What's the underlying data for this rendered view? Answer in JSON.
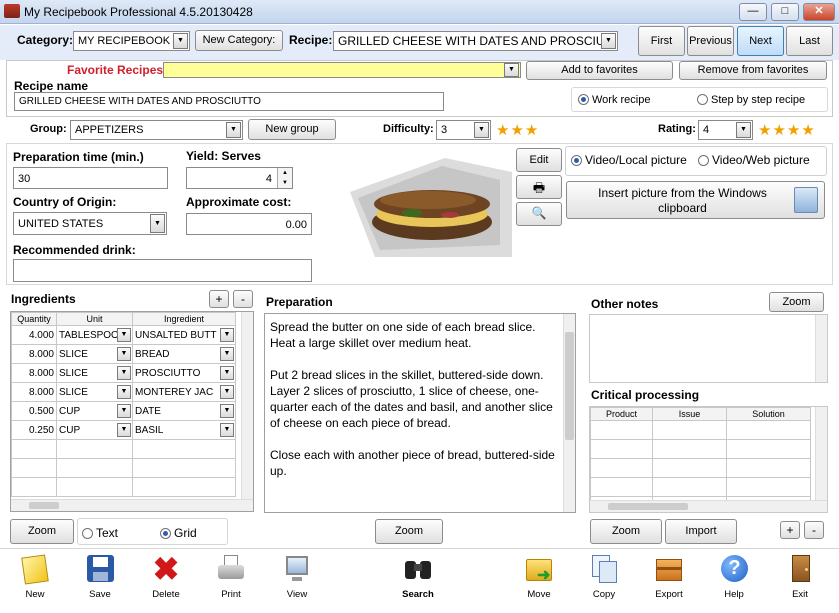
{
  "window": {
    "title": "My Recipebook Professional 4.5.20130428"
  },
  "header": {
    "category_label": "Category:",
    "category_value": "MY RECIPEBOOK",
    "new_category": "New Category:",
    "recipe_label": "Recipe:",
    "recipe_value": "GRILLED CHEESE WITH DATES AND PROSCIU",
    "nav": [
      "First",
      "Previous",
      "Next",
      "Last"
    ]
  },
  "favorites": {
    "label": "Favorite Recipes",
    "add": "Add to favorites",
    "remove": "Remove from favorites"
  },
  "recipe": {
    "name_label": "Recipe name",
    "name_value": "GRILLED CHEESE WITH DATES AND PROSCIUTTO",
    "mode_work": "Work recipe",
    "mode_step": "Step by step recipe"
  },
  "group": {
    "label": "Group:",
    "value": "APPETIZERS",
    "new": "New group"
  },
  "difficulty": {
    "label": "Difficulty:",
    "value": "3",
    "stars": 3
  },
  "rating": {
    "label": "Rating:",
    "value": "4",
    "stars": 4
  },
  "details": {
    "prep_label": "Preparation time (min.)",
    "prep_value": "30",
    "yield_label": "Yield: Serves",
    "yield_value": "4",
    "country_label": "Country of Origin:",
    "country_value": "UNITED STATES",
    "cost_label": "Approximate cost:",
    "cost_value": "0.00",
    "drink_label": "Recommended drink:",
    "drink_value": ""
  },
  "picture": {
    "edit": "Edit",
    "video_local": "Video/Local picture",
    "video_web": "Video/Web picture",
    "insert": "Insert picture from the Windows clipboard"
  },
  "ingredients": {
    "label": "Ingredients",
    "columns": [
      "Quantity",
      "Unit",
      "Ingredient"
    ],
    "rows": [
      [
        "4.000",
        "TABLESPOO",
        "UNSALTED BUTT"
      ],
      [
        "8.000",
        "SLICE",
        "BREAD"
      ],
      [
        "8.000",
        "SLICE",
        "PROSCIUTTO"
      ],
      [
        "8.000",
        "SLICE",
        "MONTEREY JAC"
      ],
      [
        "0.500",
        "CUP",
        "DATE"
      ],
      [
        "0.250",
        "CUP",
        "BASIL"
      ]
    ],
    "zoom": "Zoom",
    "view_text": "Text",
    "view_grid": "Grid"
  },
  "preparation": {
    "label": "Preparation",
    "p1": "Spread the butter on one side of each bread slice. Heat a large skillet over medium heat.",
    "p2": "Put 2 bread slices in the skillet, buttered-side down. Layer 2 slices of prosciutto, 1 slice of cheese, one-quarter each of the dates and basil, and another slice of cheese on each piece of bread.",
    "p3": "Close each with another piece of bread, buttered-side up.",
    "zoom": "Zoom"
  },
  "notes": {
    "label": "Other notes",
    "zoom": "Zoom"
  },
  "critical": {
    "label": "Critical processing",
    "columns": [
      "Product",
      "Issue",
      "Solution"
    ],
    "zoom": "Zoom",
    "import": "Import"
  },
  "toolbar": {
    "new": "New",
    "save": "Save",
    "delete": "Delete",
    "print": "Print",
    "view": "View",
    "search": "Search",
    "move": "Move",
    "copy": "Copy",
    "export": "Export",
    "help": "Help",
    "exit": "Exit"
  },
  "colors": {
    "title_bg": "#c3d5ee",
    "favorite_label": "#d11f2d",
    "favorite_field": "#ffff99",
    "star": "#f2a000"
  }
}
